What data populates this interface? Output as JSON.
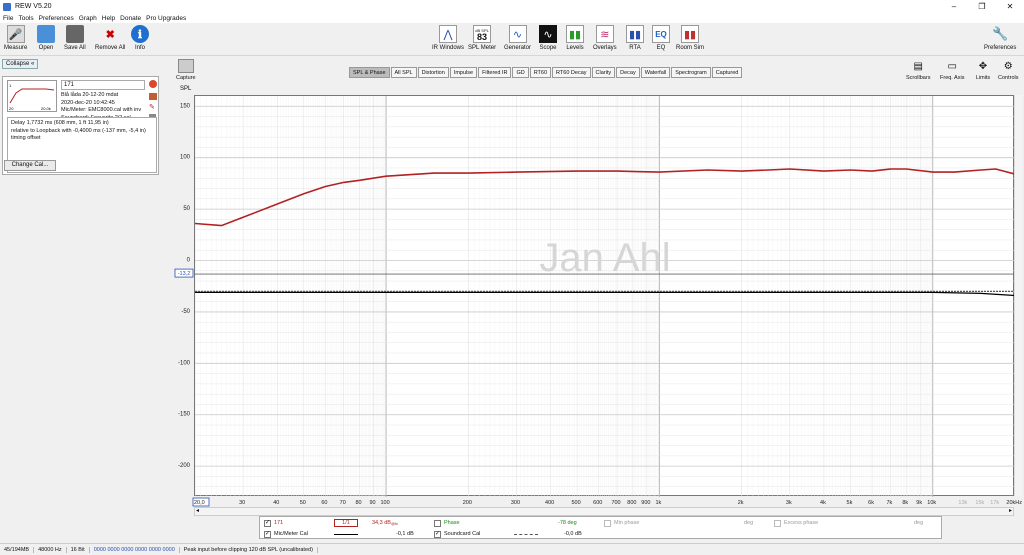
{
  "window": {
    "title": "REW V5.20",
    "minimize": "–",
    "maximize": "❐",
    "close": "✕"
  },
  "menu": [
    "File",
    "Tools",
    "Preferences",
    "Graph",
    "Help",
    "Donate",
    "Pro Upgrades"
  ],
  "toolbar": {
    "left": [
      {
        "label": "Measure",
        "icon": "measure-icon",
        "glyph": "🎤"
      },
      {
        "label": "Open",
        "icon": "open-folder-icon",
        "glyph": "📂"
      },
      {
        "label": "Save All",
        "icon": "save-icon",
        "glyph": "💾"
      },
      {
        "label": "Remove All",
        "icon": "remove-all-icon",
        "glyph": "✖"
      },
      {
        "label": "Info",
        "icon": "info-icon",
        "glyph": "ℹ"
      }
    ],
    "center": [
      {
        "label": "IR Windows",
        "icon": "ir-windows-icon",
        "glyph": "⋀"
      },
      {
        "label": "SPL Meter",
        "icon": "spl-meter-icon",
        "glyph": "83"
      },
      {
        "label": "Generator",
        "icon": "generator-icon",
        "glyph": "∿"
      },
      {
        "label": "Scope",
        "icon": "scope-icon",
        "glyph": "∿"
      },
      {
        "label": "Levels",
        "icon": "levels-icon",
        "glyph": "▮▮"
      },
      {
        "label": "Overlays",
        "icon": "overlays-icon",
        "glyph": "≋"
      },
      {
        "label": "RTA",
        "icon": "rta-icon",
        "glyph": "▮▮"
      },
      {
        "label": "EQ",
        "icon": "eq-icon",
        "glyph": "EQ"
      },
      {
        "label": "Room Sim",
        "icon": "room-sim-icon",
        "glyph": "▮▮"
      }
    ],
    "spl_meter_header": "dB SPL",
    "preferences": "Preferences"
  },
  "left_panel": {
    "collapse": "Collapse",
    "measurement_name": "171",
    "info_lines": [
      "Blå låda 20-12-20 mdat",
      "2020-dec-20 10:42:45",
      "Mic/Meter: EMC8000.cal with inv",
      "Soundcard: Focusrite 2i2.cal"
    ],
    "note_lines": [
      "Delay 1,7732 ms (608 mm, 1 ft 11,95 in)",
      " relative to Loopback with -0,4000 ms (-137 mm, -5,4 in)",
      "timing offset"
    ],
    "mini_axis_left": "20",
    "mini_axis_right": "20.0k",
    "mini_axis_top": "1",
    "change_cal": "Change Cal..."
  },
  "graph_tools": {
    "capture": "Capture",
    "right": [
      {
        "label": "Scrollbars",
        "icon": "scrollbars-icon"
      },
      {
        "label": "Freq. Axis",
        "icon": "freq-axis-icon"
      },
      {
        "label": "Limits",
        "icon": "limits-icon"
      },
      {
        "label": "Controls",
        "icon": "controls-icon"
      }
    ]
  },
  "tabs": [
    "SPL & Phase",
    "All SPL",
    "Distortion",
    "Impulse",
    "Filtered IR",
    "GD",
    "RT60",
    "RT60 Decay",
    "Clarity",
    "Decay",
    "Waterfall",
    "Spectrogram",
    "Captured"
  ],
  "active_tab": "SPL & Phase",
  "chart_data": {
    "type": "line",
    "ylabel": "SPL",
    "ylim": [
      -230,
      160
    ],
    "xlim": [
      20,
      20000
    ],
    "xscale": "log",
    "grid": true,
    "y_ticks": [
      150,
      100,
      50,
      0,
      -50,
      -100,
      -150,
      -200
    ],
    "x_tick_labels": [
      "20,0",
      "30",
      "40",
      "50",
      "60",
      "70",
      "80",
      "90",
      "100",
      "200",
      "300",
      "400",
      "500",
      "600",
      "700",
      "800",
      "900",
      "1k",
      "2k",
      "3k",
      "4k",
      "5k",
      "6k",
      "7k",
      "8k",
      "9k",
      "10k",
      "13k",
      "15k",
      "17k",
      "20kHz"
    ],
    "x_tick_values": [
      20,
      30,
      40,
      50,
      60,
      70,
      80,
      90,
      100,
      200,
      300,
      400,
      500,
      600,
      700,
      800,
      900,
      1000,
      2000,
      3000,
      4000,
      5000,
      6000,
      7000,
      8000,
      9000,
      10000,
      13000,
      15000,
      17000,
      20000
    ],
    "cursor_value_label": "-13,2",
    "watermark": "Jan Ahl",
    "series": [
      {
        "name": "171",
        "color": "#b22222",
        "x": [
          20,
          25,
          30,
          40,
          50,
          60,
          70,
          80,
          100,
          150,
          200,
          300,
          500,
          700,
          1000,
          1500,
          2000,
          2500,
          3000,
          4000,
          5000,
          6000,
          7000,
          8000,
          10000,
          12000,
          15000,
          17000,
          20000
        ],
        "y": [
          36,
          34,
          42,
          55,
          65,
          72,
          76,
          78,
          82,
          85,
          85,
          86,
          87,
          87,
          86,
          88,
          87,
          88,
          89,
          87,
          88,
          87,
          89,
          89,
          86,
          86,
          88,
          89,
          84
        ]
      },
      {
        "name": "Mic/Meter Cal",
        "color": "#000000",
        "x": [
          20,
          100,
          1000,
          5000,
          10000,
          15000,
          20000
        ],
        "y": [
          -31,
          -31,
          -31,
          -31,
          -31,
          -32,
          -34
        ]
      },
      {
        "name": "Soundcard Cal",
        "color": "#555555",
        "x": [
          20,
          100,
          1000,
          10000,
          20000
        ],
        "y": [
          -30,
          -30,
          -30,
          -30,
          -30
        ]
      },
      {
        "name": "Phase",
        "color": "#1a8a1a",
        "x": [
          20,
          20000
        ],
        "y": [
          -13.2,
          -13.2
        ]
      }
    ]
  },
  "legend": {
    "rows": [
      {
        "checked": true,
        "name": "171",
        "value": "34,3 dB",
        "value_sup": "@fc",
        "color": "#b22222"
      },
      {
        "checked": true,
        "name": "Mic/Meter Cal",
        "value": "-0,1 dB",
        "color": "#000000"
      },
      {
        "checked": false,
        "name": "Phase",
        "value": "-78 deg",
        "color": "#1a8a1a"
      },
      {
        "checked": true,
        "name": "Soundcard Cal",
        "value": "-0,0 dB",
        "color": "#555555"
      },
      {
        "checked": false,
        "name": "Min phase",
        "value": "deg",
        "color": "#999999"
      },
      {
        "checked": false,
        "name": "Excess phase",
        "value": "deg",
        "color": "#999999"
      }
    ],
    "avg_label": "1/1"
  },
  "status": [
    "45/194MB",
    "48000 Hz",
    "16 Bit",
    "0000 0000 0000 0000 0000 0000",
    "Peak input before clipping 120 dB SPL (uncalibrated)"
  ]
}
